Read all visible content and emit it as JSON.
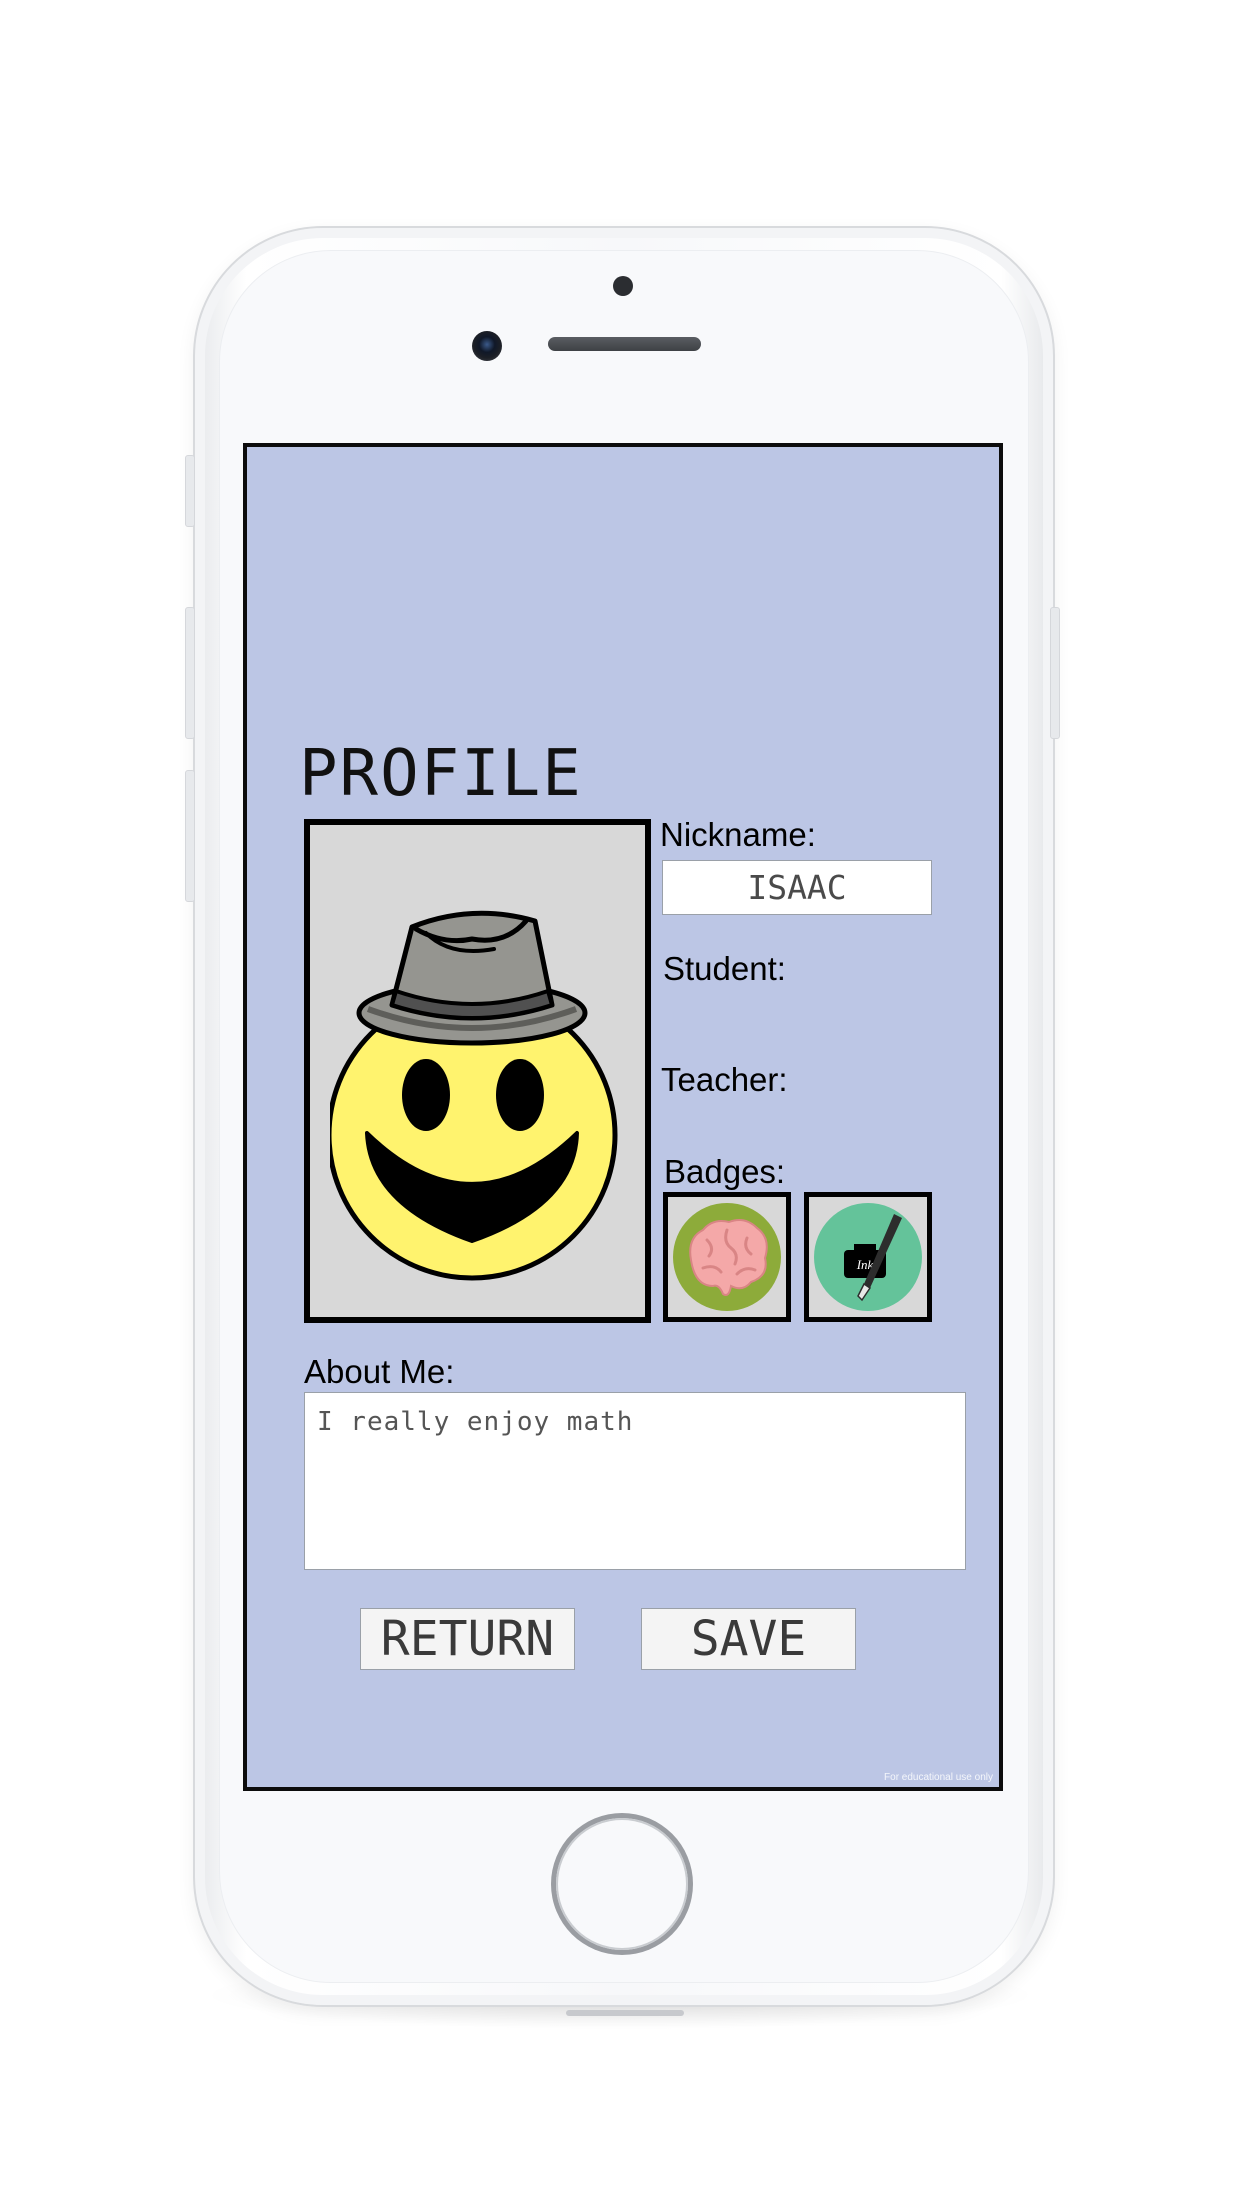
{
  "screen": {
    "title": "PROFILE",
    "nickname_label": "Nickname:",
    "nickname_value": "ISAAC",
    "student_label": "Student:",
    "teacher_label": "Teacher:",
    "badges_label": "Badges:",
    "badges": [
      {
        "icon": "brain-badge-icon"
      },
      {
        "icon": "ink-pen-badge-icon",
        "text": "Ink"
      }
    ],
    "about_label": "About Me:",
    "about_value": "I really enjoy math",
    "return_label": "RETURN",
    "save_label": "SAVE",
    "footnote": "For educational use only"
  },
  "colors": {
    "screen_background": "#bcc6e5",
    "avatar_background": "#d8d8d8",
    "face_yellow": "#fff36e",
    "hat_gray": "#959590",
    "brain_badge_bg": "#8dab3a",
    "ink_badge_bg": "#64c39a"
  }
}
